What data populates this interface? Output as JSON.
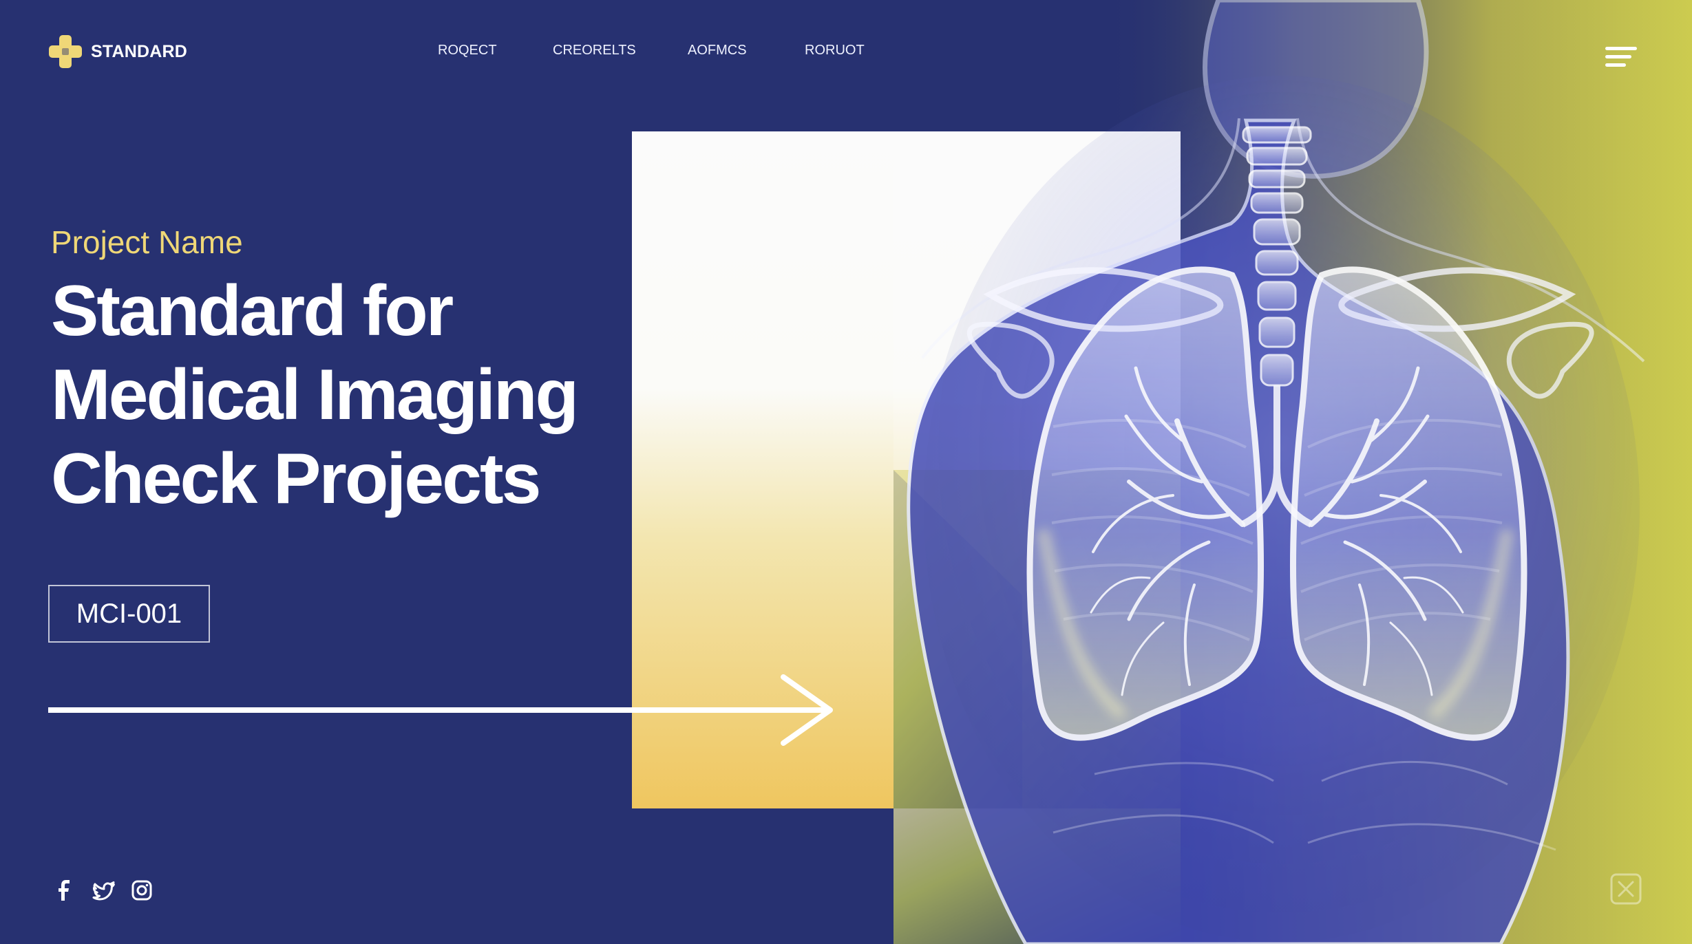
{
  "colors": {
    "primary_navy": "#273171",
    "accent_yellow": "#efd777",
    "white": "#ffffff",
    "soft_lime": "#d8d85c",
    "xray_blue": "#c8ceff"
  },
  "header": {
    "brand": {
      "name": "STANDARD",
      "icon": "medical-cross-logo-icon"
    },
    "nav": [
      {
        "label": "ROQECT"
      },
      {
        "label": "CREORELTS"
      },
      {
        "label": "AOFMCS"
      },
      {
        "label": "RORUOT"
      }
    ],
    "menu_icon": "hamburger-menu-icon"
  },
  "hero": {
    "eyebrow": "Project Name",
    "headline_lines": [
      "Standard for",
      "Medical Imaging",
      "Check Projects"
    ],
    "project_code": "MCI-001",
    "cta_icon": "long-right-arrow-icon"
  },
  "visual": {
    "illustration_icon": "chest-xray-lungs-illustration",
    "background_shapes": "white-yellow-gradient-panels"
  },
  "footer": {
    "social": [
      {
        "name": "facebook-icon"
      },
      {
        "name": "twitter-bird-icon"
      },
      {
        "name": "instagram-icon"
      }
    ],
    "corner_icon": "close-square-icon"
  }
}
